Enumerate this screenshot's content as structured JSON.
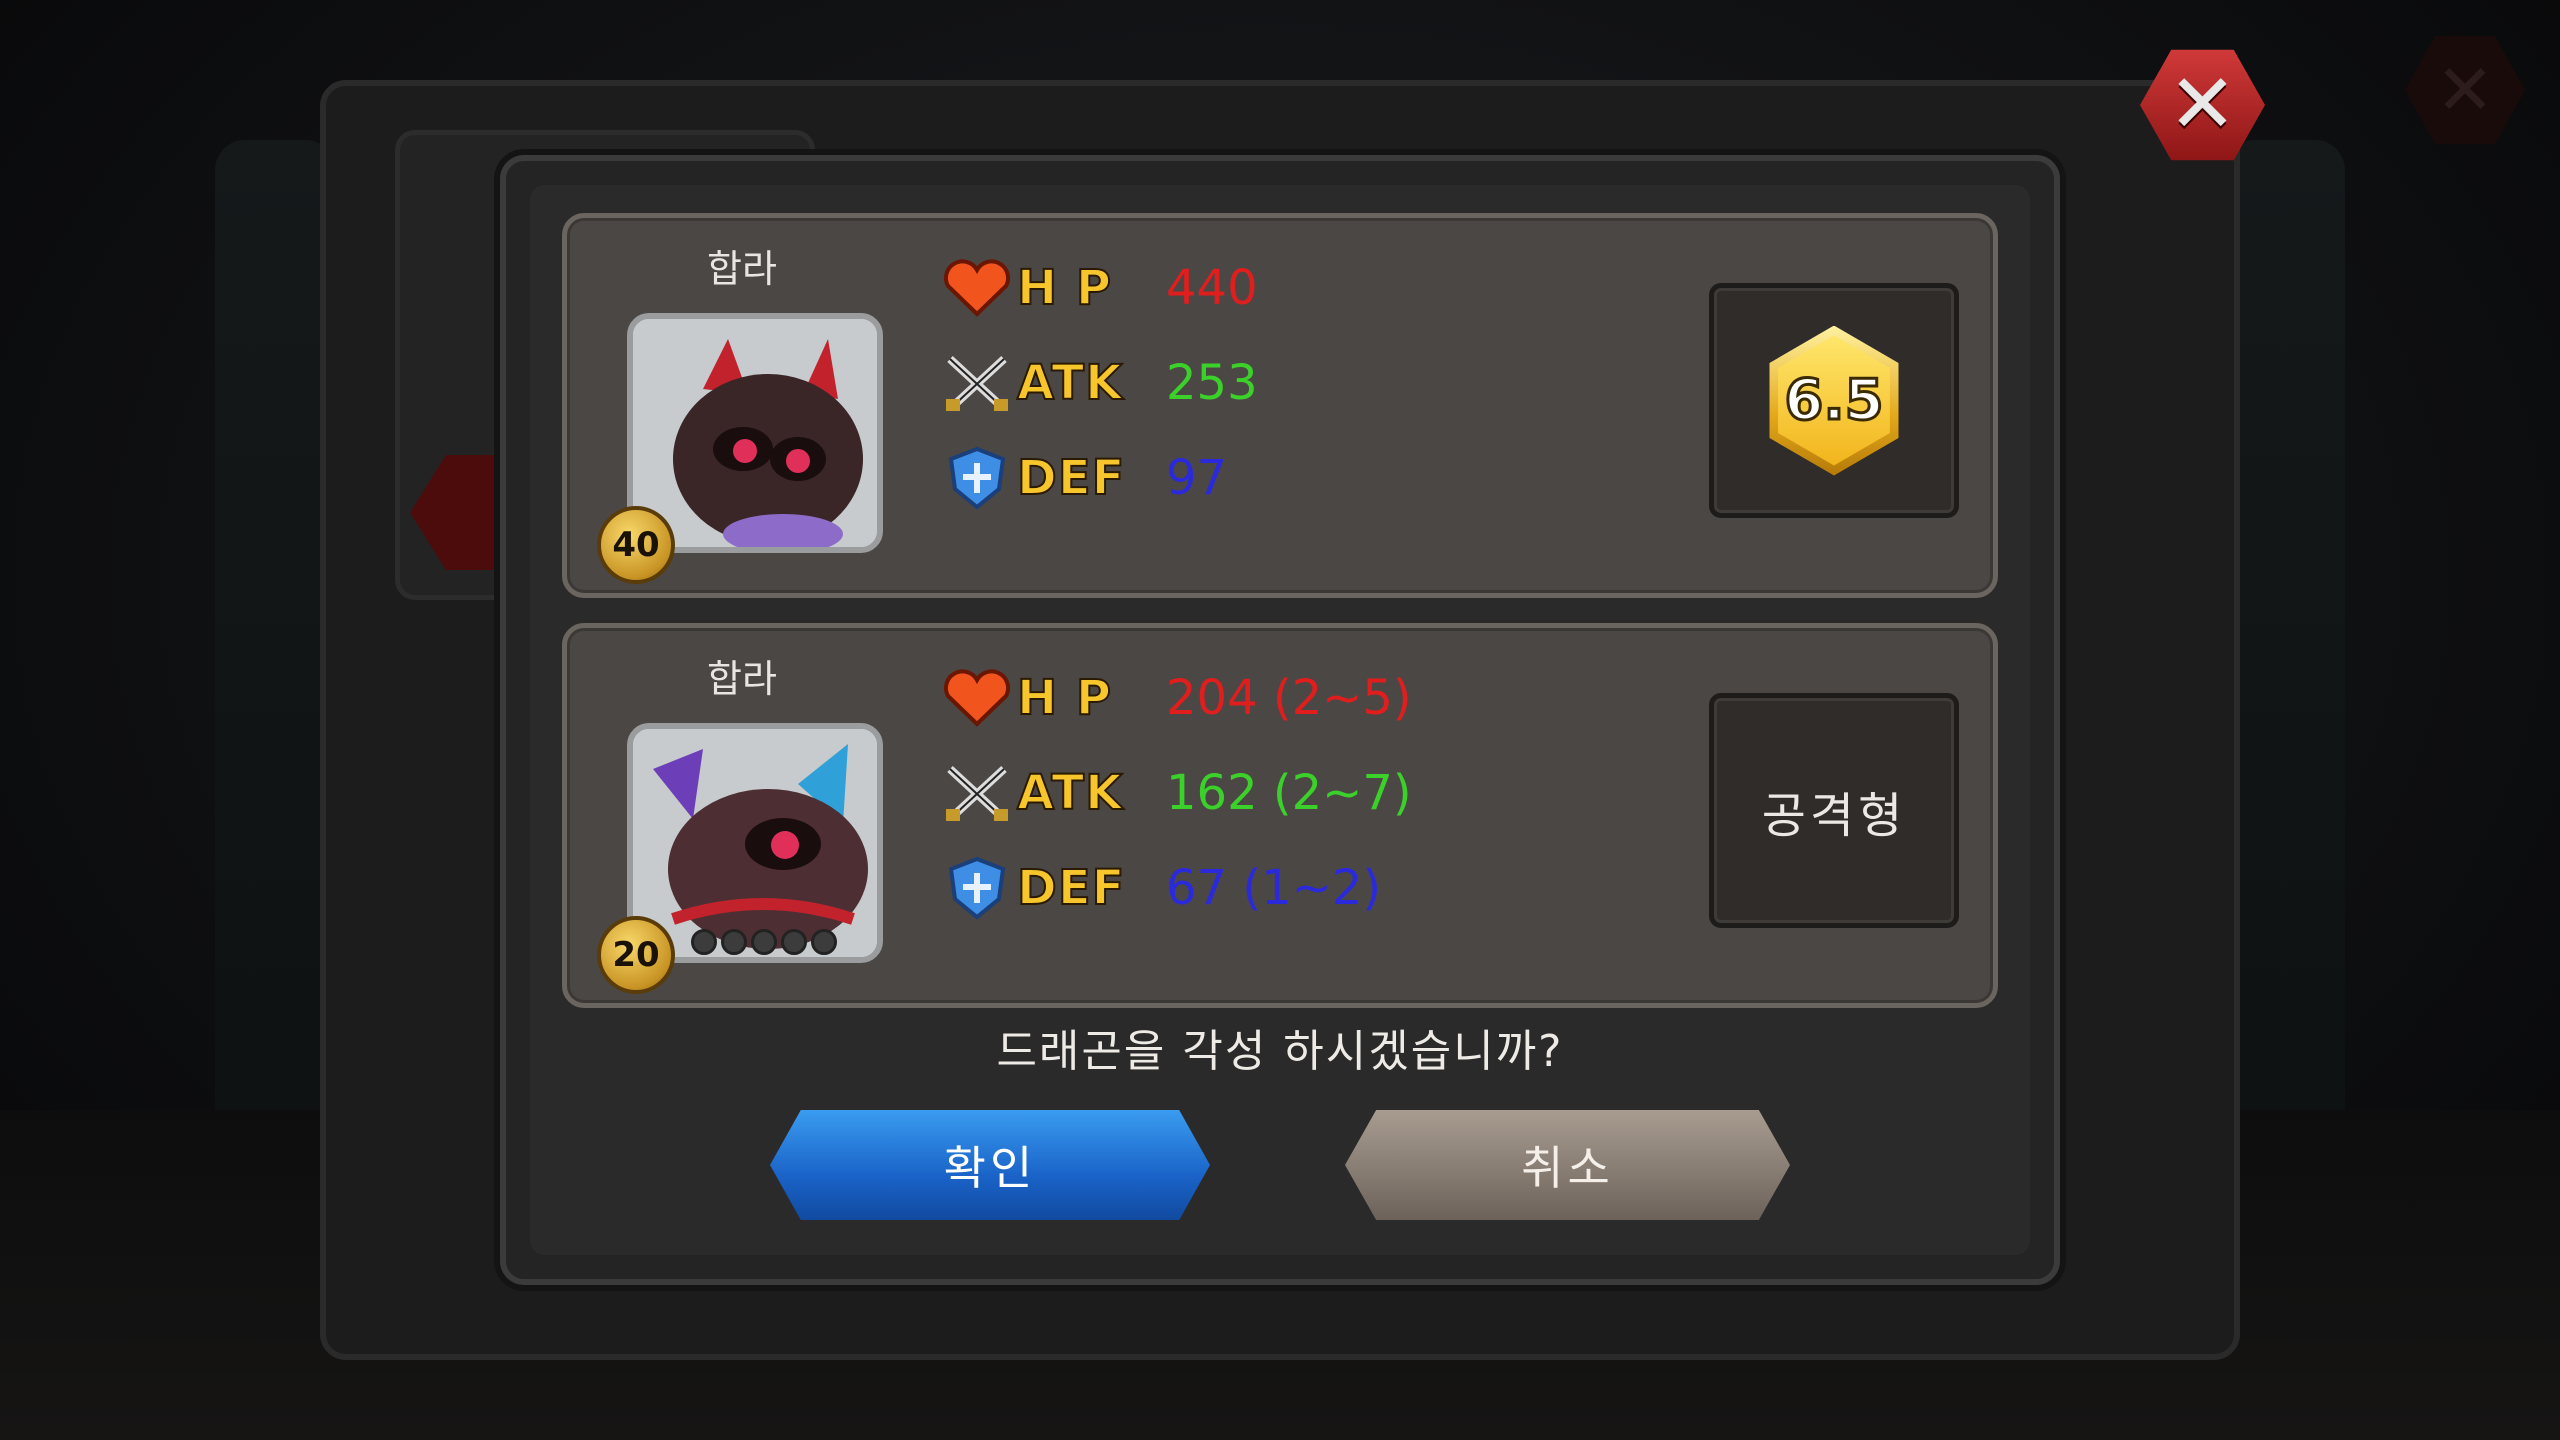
{
  "cards": [
    {
      "name": "합라",
      "level": "40",
      "hp_label": "H P",
      "atk_label": "ATK",
      "def_label": "DEF",
      "hp": "440",
      "atk": "253",
      "def": "97",
      "side": "6.5"
    },
    {
      "name": "합라",
      "level": "20",
      "hp_label": "H P",
      "atk_label": "ATK",
      "def_label": "DEF",
      "hp": "204 (2~5)",
      "atk": "162 (2~7)",
      "def": "67 (1~2)",
      "side": "공격형"
    }
  ],
  "question": "드래곤을 각성 하시겠습니까?",
  "buttons": {
    "confirm": "확인",
    "cancel": "취소"
  },
  "icons": {
    "close": "close-icon",
    "hp": "heart-icon",
    "atk": "crossed-swords-icon",
    "def": "shield-icon"
  },
  "colors": {
    "hp": "#e01e1e",
    "atk": "#3cd02a",
    "def": "#2a2adc",
    "confirm": "#1a63c8",
    "cancel": "#857a70"
  }
}
